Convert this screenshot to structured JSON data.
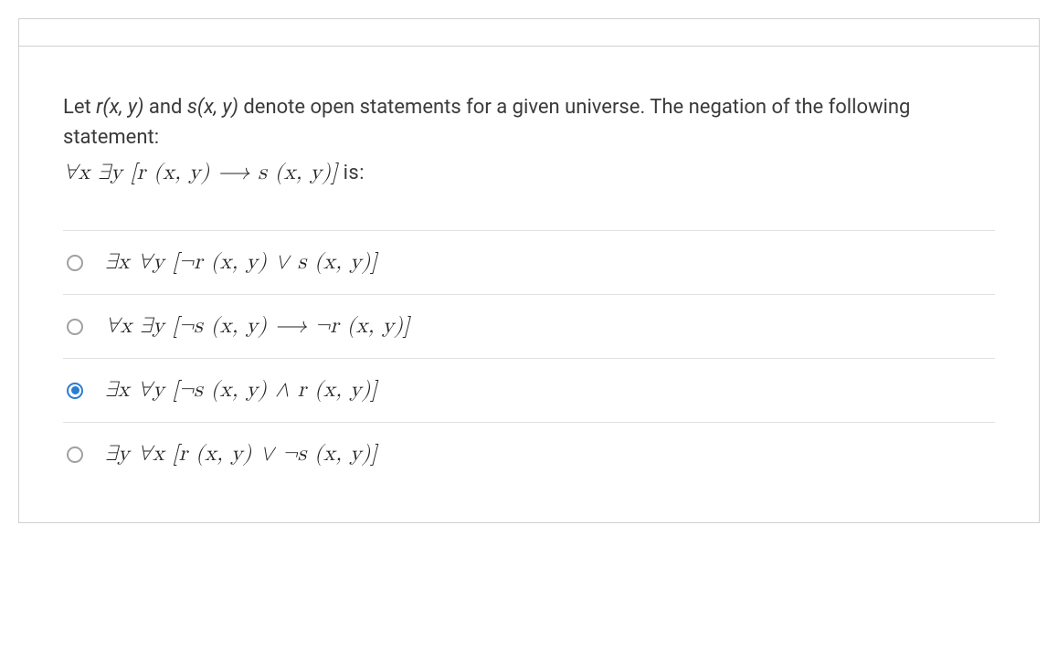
{
  "question": {
    "preamble_part1": "Let ",
    "r_func": "r(x, y)",
    "preamble_part2": " and ",
    "s_func": "s(x, y)",
    "preamble_part3": " denote open statements for a given universe. The negation of the following statement:",
    "formula": "∀x ∃y [r (x, y)  ⟶  s (x, y)]",
    "formula_suffix": " is:"
  },
  "options": [
    {
      "formula": "∃x ∀y [¬r (x, y)  ∨  s (x, y)]",
      "selected": false
    },
    {
      "formula": "∀x ∃y [¬s (x, y)  ⟶  ¬r (x, y)]",
      "selected": false
    },
    {
      "formula": "∃x ∀y [¬s (x, y)  ∧  r (x, y)]",
      "selected": true
    },
    {
      "formula": "∃y ∀x [r (x, y)  ∨  ¬s (x, y)]",
      "selected": false
    }
  ]
}
